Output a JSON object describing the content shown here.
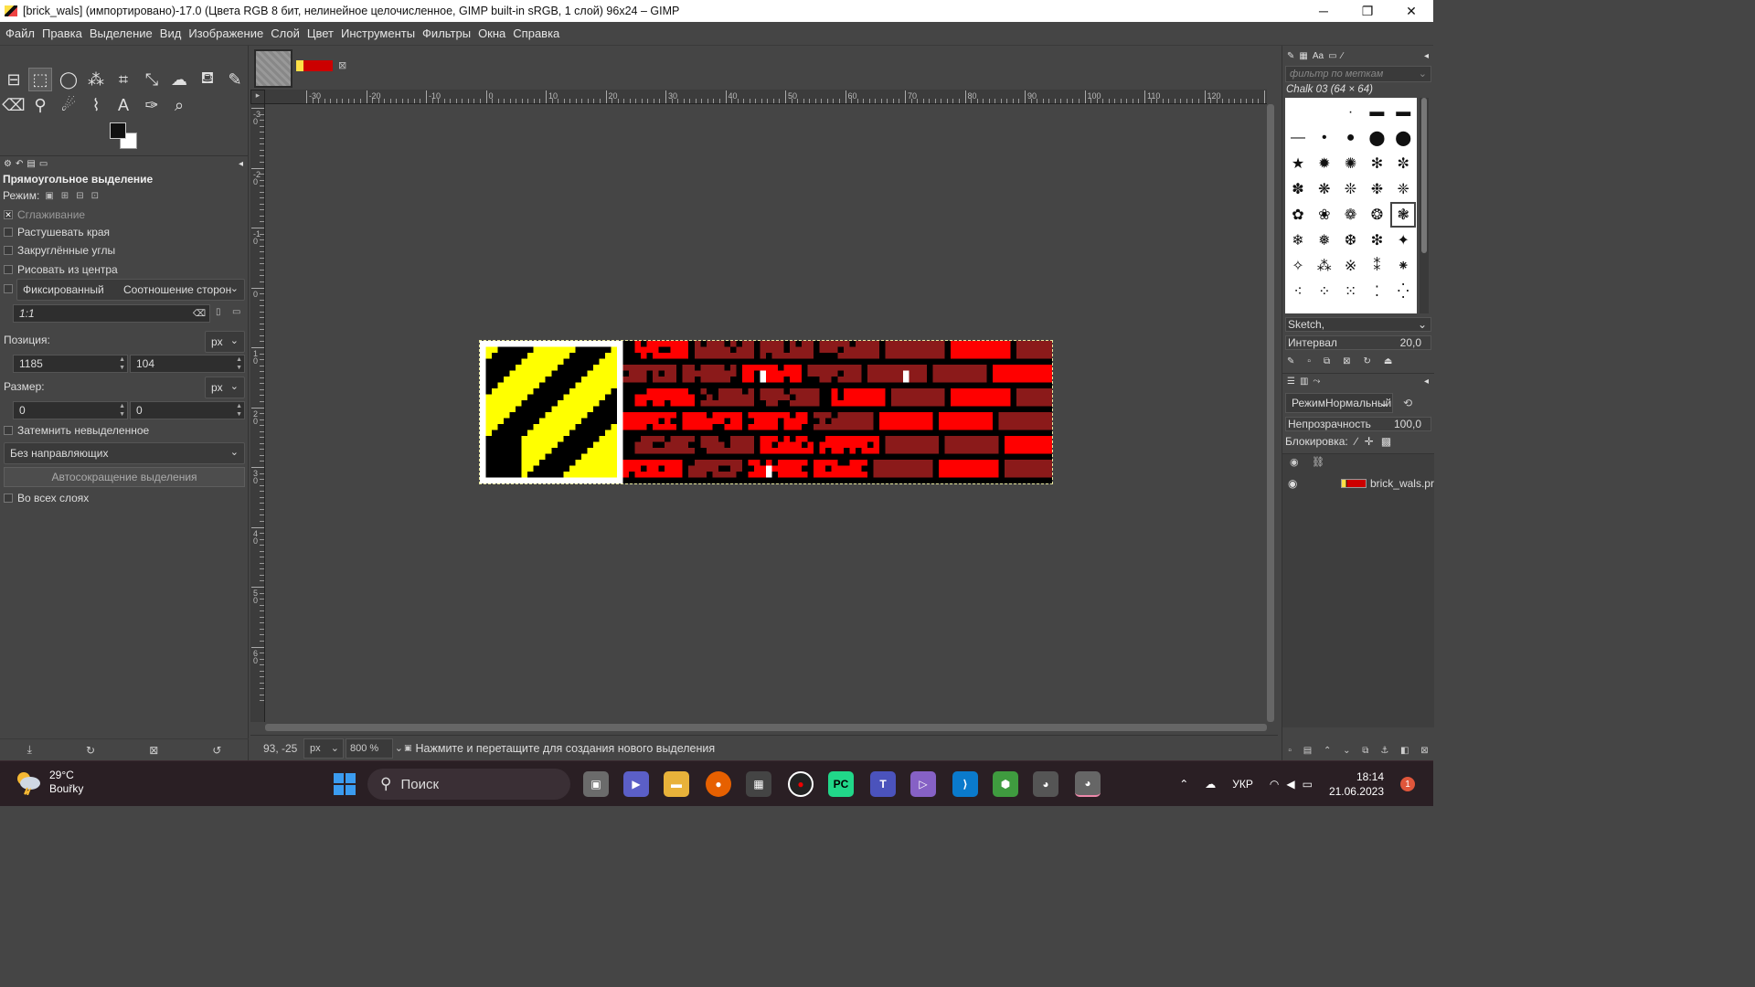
{
  "window": {
    "title": "[brick_wals] (импортировано)-17.0 (Цвета RGB 8 бит, нелинейное целочисленное, GIMP built-in sRGB, 1 слой) 96x24 – GIMP",
    "minimize": "─",
    "maximize": "❐",
    "close": "✕"
  },
  "menu": [
    "Файл",
    "Правка",
    "Выделение",
    "Вид",
    "Изображение",
    "Слой",
    "Цвет",
    "Инструменты",
    "Фильтры",
    "Окна",
    "Справка"
  ],
  "tool_options": {
    "title": "Прямоугольное выделение",
    "mode_label": "Режим:",
    "antialias": "Сглаживание",
    "feather": "Растушевать края",
    "rounded": "Закруглённые углы",
    "from_center": "Рисовать из центра",
    "fixed": "Фиксированный",
    "fixed_option": "Соотношение сторон",
    "ratio": "1:1",
    "position_label": "Позиция:",
    "position_unit": "px",
    "pos_x": "1185",
    "pos_y": "104",
    "size_label": "Размер:",
    "size_unit": "px",
    "size_w": "0",
    "size_h": "0",
    "shrink_unselected": "Затемнить невыделенное",
    "guides": "Без направляющих",
    "auto_shrink": "Автосокращение выделения",
    "all_layers": "Во всех слоях"
  },
  "ruler": {
    "h_labels": [
      "-30",
      "-20",
      "-10",
      "0",
      "10",
      "20",
      "30",
      "40",
      "50",
      "60",
      "70",
      "80",
      "90",
      "100",
      "110",
      "120",
      "13"
    ],
    "v_labels": [
      "-30",
      "-20",
      "-10",
      "0",
      "10",
      "20",
      "30",
      "40",
      "50",
      "60"
    ]
  },
  "status": {
    "coords": "93, -25",
    "unit": "px",
    "zoom": "800 %",
    "message": "Нажмите и перетащите для создания нового выделения"
  },
  "brushes": {
    "filter_placeholder": "фильтр по меткам",
    "current": "Chalk 03 (64 × 64)",
    "tag": "Sketch,",
    "spacing_label": "Интервал",
    "spacing_value": "20,0"
  },
  "layers": {
    "mode_label": "Режим",
    "mode_value": "Нормальный",
    "opacity_label": "Непрозрачность",
    "opacity_value": "100,0",
    "lock_label": "Блокировка:",
    "layer_name": "brick_wals.pr"
  },
  "taskbar": {
    "temp": "29°C",
    "weather": "Bouřky",
    "search": "Поиск",
    "lang": "УКР",
    "time": "18:14",
    "date": "21.06.2023",
    "notifications": "1"
  },
  "colors": {
    "bg": "#454545",
    "brick_red": "#ff0000",
    "brick_dark": "#8b1a1a",
    "hazard_yellow": "#ffff00"
  }
}
